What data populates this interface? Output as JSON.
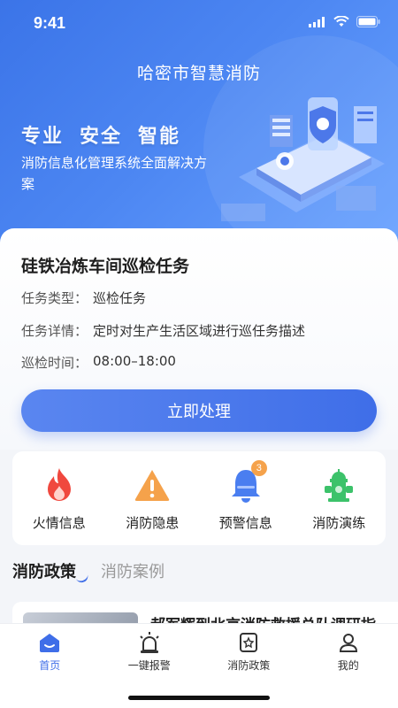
{
  "status_bar": {
    "time": "9:41"
  },
  "header": {
    "title": "哈密市智慧消防"
  },
  "hero": {
    "slogans": [
      "专业",
      "安全",
      "智能"
    ],
    "description": "消防信息化管理系统全面解决方案"
  },
  "task": {
    "title": "硅铁冶炼车间巡检任务",
    "type_label": "任务类型：",
    "type_value": "巡检任务",
    "detail_label": "任务详情：",
    "detail_value": "定时对生产生活区域进行巡任务描述",
    "time_label": "巡检时间：",
    "time_value": "08:00–18:00",
    "action_label": "立即处理"
  },
  "quick_actions": [
    {
      "label": "火情信息",
      "icon": "fire-icon",
      "color": "#f0483e"
    },
    {
      "label": "消防隐患",
      "icon": "warning-icon",
      "color": "#f5a24b"
    },
    {
      "label": "预警信息",
      "icon": "alarm-bell-icon",
      "color": "#4a7ef0",
      "badge": "3"
    },
    {
      "label": "消防演练",
      "icon": "fire-hydrant-icon",
      "color": "#3cc26a"
    }
  ],
  "tabs": [
    {
      "label": "消防政策",
      "active": true
    },
    {
      "label": "消防案例",
      "active": false
    }
  ],
  "news": {
    "title": "郝军辉到北京消防救援总队调研指"
  },
  "bottom_nav": [
    {
      "label": "首页",
      "icon": "home-icon",
      "active": true
    },
    {
      "label": "一键报警",
      "icon": "siren-icon",
      "active": false
    },
    {
      "label": "消防政策",
      "icon": "policy-icon",
      "active": false
    },
    {
      "label": "我的",
      "icon": "user-icon",
      "active": false
    }
  ],
  "colors": {
    "primary": "#3f6ee8",
    "hero_start": "#3b74e8",
    "hero_end": "#6aa3ff"
  }
}
